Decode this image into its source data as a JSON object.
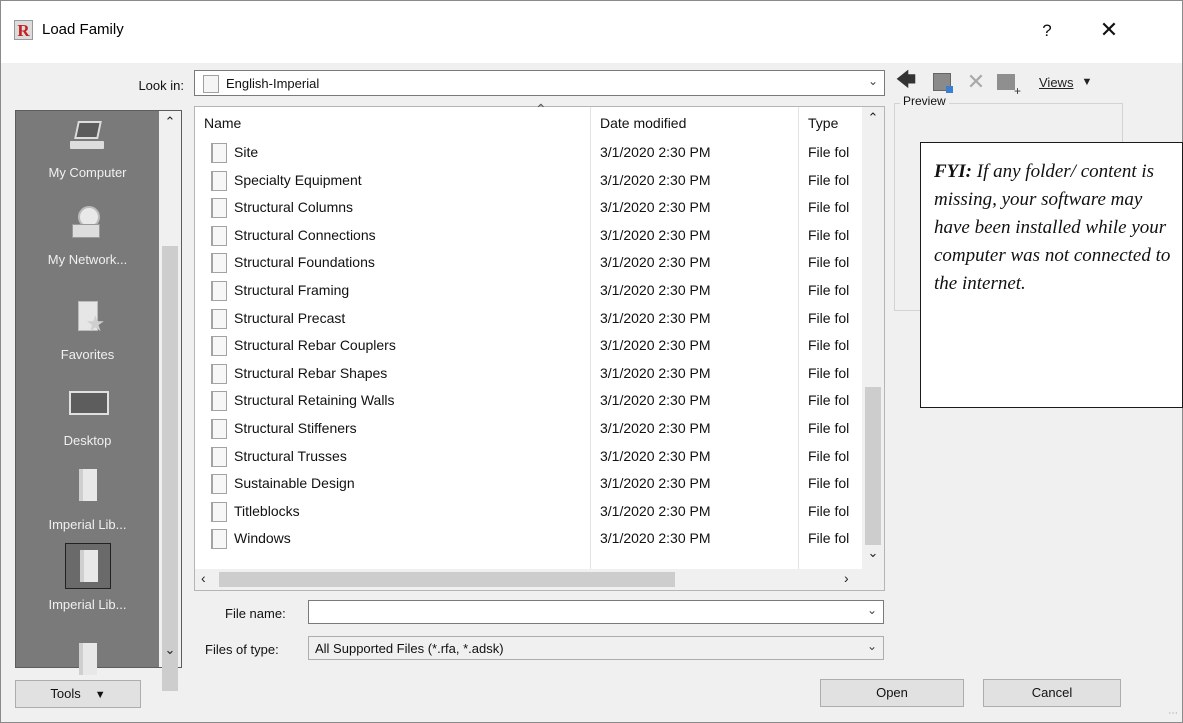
{
  "window": {
    "title": "Load Family",
    "logo_letter": "R",
    "help_glyph": "?",
    "close_glyph": "✕"
  },
  "lookin": {
    "label": "Look in:",
    "value": "English-Imperial"
  },
  "toolbar": {
    "views_label": "Views",
    "icons": [
      "back-arrow-icon",
      "up-folder-icon",
      "delete-icon",
      "new-folder-icon",
      "chevron-down-icon"
    ]
  },
  "places": [
    {
      "label": "My Computer",
      "icon": "computer-icon"
    },
    {
      "label": "My Network...",
      "icon": "network-icon"
    },
    {
      "label": "Favorites",
      "icon": "favorites-icon"
    },
    {
      "label": "Desktop",
      "icon": "desktop-icon"
    },
    {
      "label": "Imperial Lib...",
      "icon": "library-icon"
    },
    {
      "label": "Imperial Lib...",
      "icon": "library-icon",
      "selected": true
    }
  ],
  "file_list": {
    "columns": [
      "Name",
      "Date modified",
      "Type"
    ],
    "rows": [
      {
        "name": "Site",
        "date": "3/1/2020 2:30 PM",
        "type": "File fol"
      },
      {
        "name": "Specialty Equipment",
        "date": "3/1/2020 2:30 PM",
        "type": "File fol"
      },
      {
        "name": "Structural Columns",
        "date": "3/1/2020 2:30 PM",
        "type": "File fol"
      },
      {
        "name": "Structural Connections",
        "date": "3/1/2020 2:30 PM",
        "type": "File fol"
      },
      {
        "name": "Structural Foundations",
        "date": "3/1/2020 2:30 PM",
        "type": "File fol"
      },
      {
        "name": "Structural Framing",
        "date": "3/1/2020 2:30 PM",
        "type": "File fol"
      },
      {
        "name": "Structural Precast",
        "date": "3/1/2020 2:30 PM",
        "type": "File fol"
      },
      {
        "name": "Structural Rebar Couplers",
        "date": "3/1/2020 2:30 PM",
        "type": "File fol"
      },
      {
        "name": "Structural Rebar Shapes",
        "date": "3/1/2020 2:30 PM",
        "type": "File fol"
      },
      {
        "name": "Structural Retaining Walls",
        "date": "3/1/2020 2:30 PM",
        "type": "File fol"
      },
      {
        "name": "Structural Stiffeners",
        "date": "3/1/2020 2:30 PM",
        "type": "File fol"
      },
      {
        "name": "Structural Trusses",
        "date": "3/1/2020 2:30 PM",
        "type": "File fol"
      },
      {
        "name": "Sustainable Design",
        "date": "3/1/2020 2:30 PM",
        "type": "File fol"
      },
      {
        "name": "Titleblocks",
        "date": "3/1/2020 2:30 PM",
        "type": "File fol"
      },
      {
        "name": "Windows",
        "date": "3/1/2020 2:30 PM",
        "type": "File fol"
      }
    ]
  },
  "preview": {
    "label": "Preview"
  },
  "callout": {
    "lead": "FYI:",
    "body": "If any folder/ content is missing, your software may have been installed while your computer was not connected to the internet."
  },
  "file_name": {
    "label": "File name:",
    "value": ""
  },
  "file_type": {
    "label": "Files of type:",
    "value": "All Supported Files  (*.rfa, *.adsk)"
  },
  "buttons": {
    "tools": "Tools",
    "open": "Open",
    "cancel": "Cancel"
  }
}
